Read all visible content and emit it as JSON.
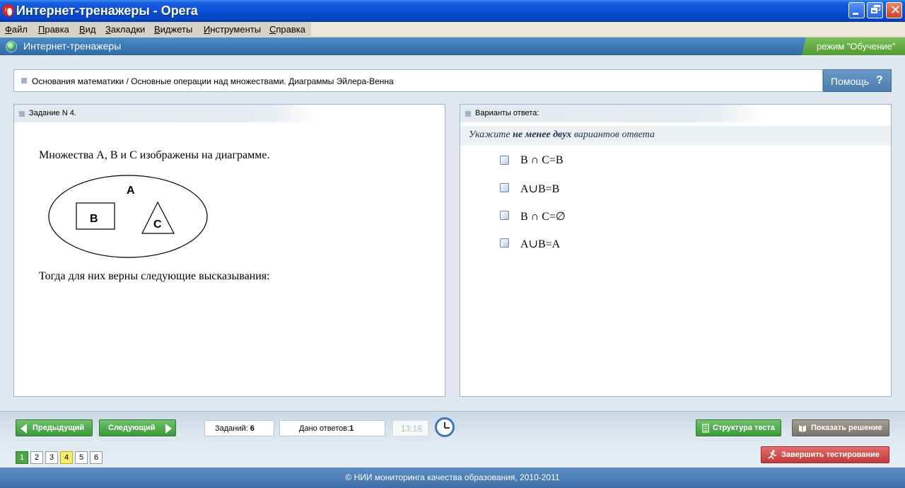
{
  "window": {
    "title": "Интернет-тренажеры - Opera"
  },
  "menu": [
    "Файл",
    "Правка",
    "Вид",
    "Закладки",
    "Виджеты",
    "Инструменты",
    "Справка"
  ],
  "app": {
    "name": "Интернет-тренажеры",
    "mode": "режим \"Обучение\""
  },
  "breadcrumb": "Основания математики / Основные операции над множествами. Диаграммы Эйлера-Венна",
  "help_label": "Помощь",
  "help_symbol": "?",
  "task": {
    "header": "Задание N 4.",
    "text": "Множества А, В и С изображены на диаграмме.",
    "diagram_labels": {
      "outer": "A",
      "rect": "B",
      "triangle": "C"
    },
    "question": "Тогда для них верны следующие высказывания:"
  },
  "answers": {
    "header": "Варианты ответа:",
    "hint_pre": "Укажите",
    "hint_bold": "не менее двух",
    "hint_post": "вариантов ответа",
    "options": [
      {
        "text": "B ∩ C=B",
        "checked": false
      },
      {
        "text": "A∪B=B",
        "checked": false
      },
      {
        "text": "B ∩ C=∅",
        "checked": false
      },
      {
        "text": "A∪B=A",
        "checked": false
      }
    ]
  },
  "nav": {
    "prev": "Предыдущий",
    "next": "Следующий",
    "tasks_label": "Заданий:",
    "tasks_count": "6",
    "answers_label": "Дано ответов:",
    "answers_count": "1",
    "timer": "13:18",
    "structure": "Структура теста",
    "show_solution": "Показать решение",
    "finish": "Завершить тестирование"
  },
  "pages": [
    {
      "num": "1",
      "state": "done"
    },
    {
      "num": "2",
      "state": "normal"
    },
    {
      "num": "3",
      "state": "normal"
    },
    {
      "num": "4",
      "state": "current"
    },
    {
      "num": "5",
      "state": "normal"
    },
    {
      "num": "6",
      "state": "normal"
    }
  ],
  "footer": "© НИИ мониторинга качества образования, 2010-2011",
  "colors": {
    "title_bar": "#0a4fd6",
    "app_bar": "#3a79b6",
    "mode_badge": "#4f9a31",
    "nav_button": "#3b9a3a",
    "finish_button": "#c23a3a",
    "current_page": "#f7ef69"
  }
}
